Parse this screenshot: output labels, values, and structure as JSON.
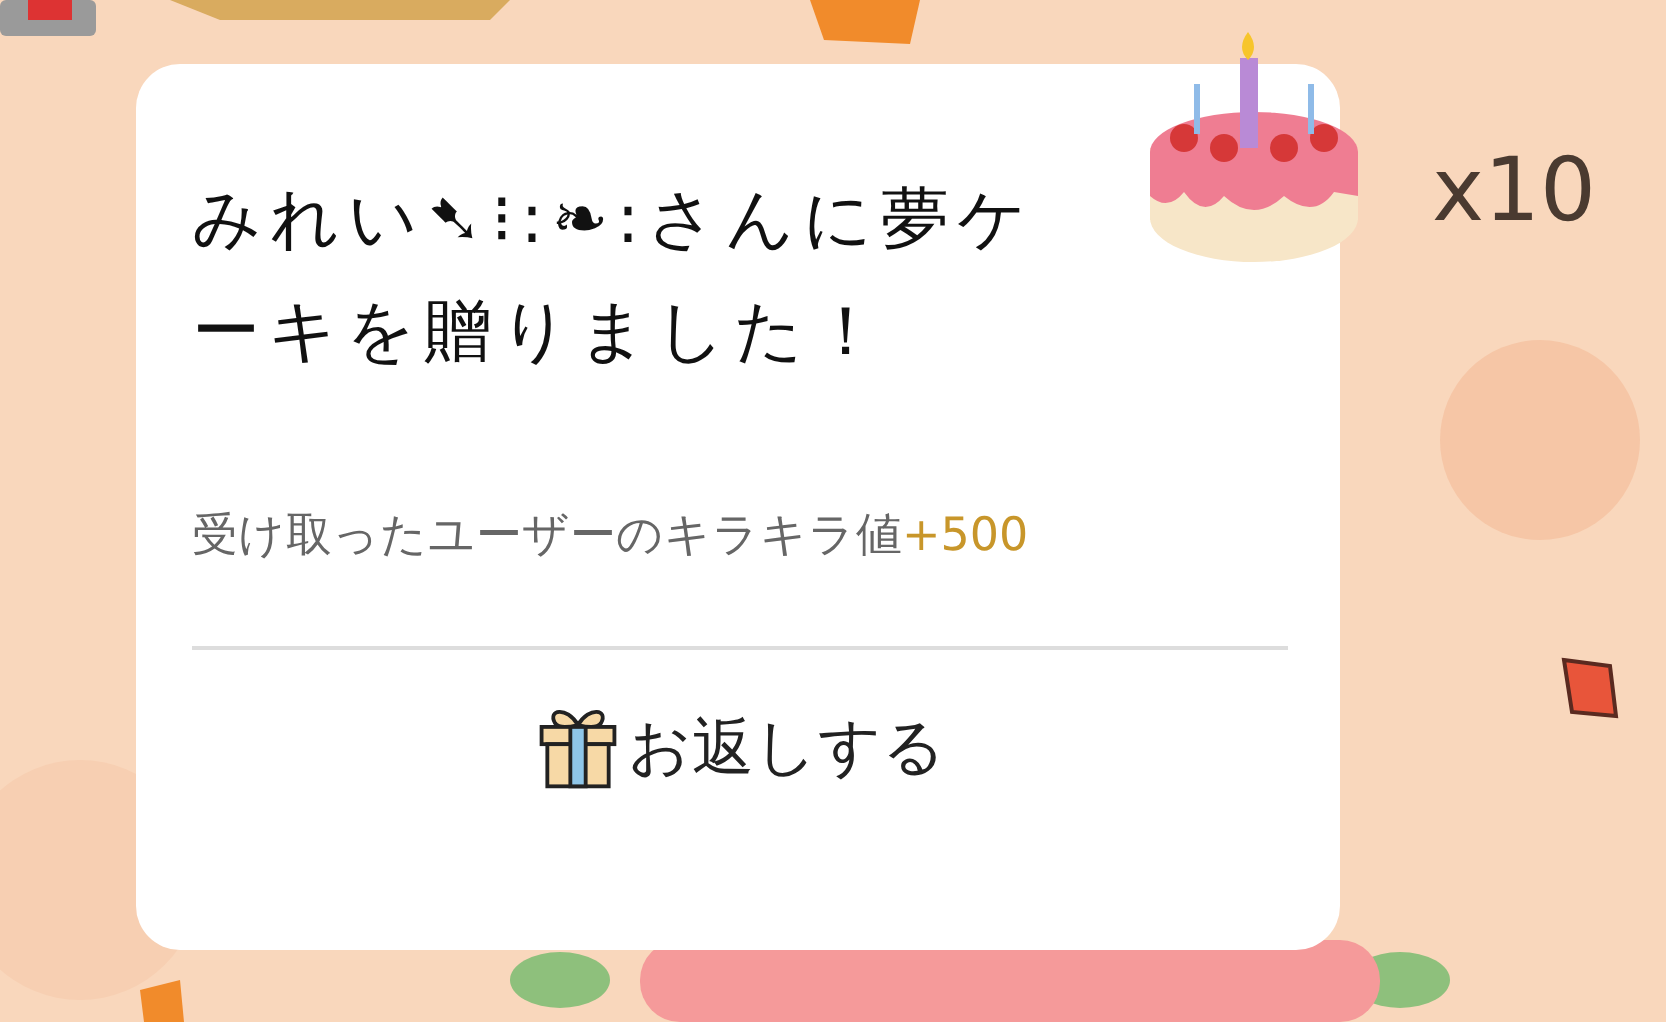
{
  "gift": {
    "count": "x10"
  },
  "dialog": {
    "title": "みれい➷⁝:❧:さんに夢ケーキを贈りました！",
    "detail": "受け取ったユーザーのキラキラ値",
    "bonus": "+500",
    "action": {
      "label": "お返しする"
    }
  }
}
